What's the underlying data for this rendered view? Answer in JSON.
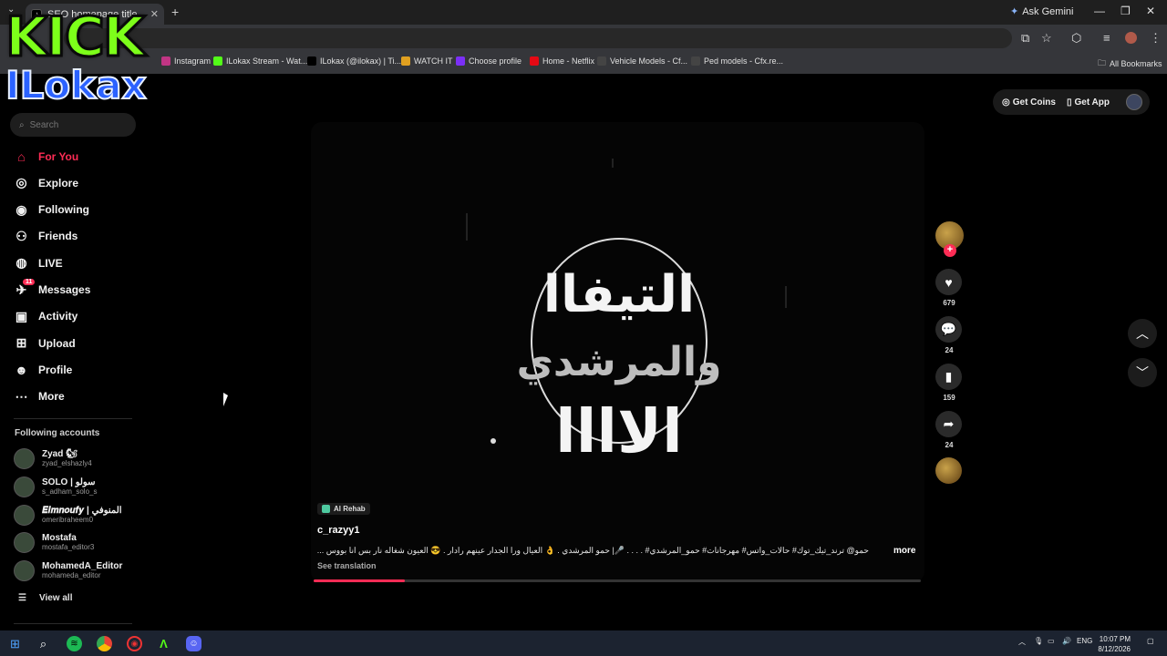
{
  "browser": {
    "tab_title": "SEO homepage title",
    "new_tab": "+",
    "ask_gemini": "Ask Gemini",
    "bookmarks": [
      {
        "label": "Instagram",
        "color": "#c13584"
      },
      {
        "label": "ILokax Stream - Wat...",
        "color": "#53fc18"
      },
      {
        "label": "ILokax (@ilokax) | Ti...",
        "color": "#000000"
      },
      {
        "label": "WATCH IT",
        "color": "#e0a020"
      },
      {
        "label": "Choose profile",
        "color": "#7b2ff7"
      },
      {
        "label": "Home - Netflix",
        "color": "#e50914"
      },
      {
        "label": "Vehicle Models - Cf...",
        "color": "#444444"
      },
      {
        "label": "Ped models - Cfx.re...",
        "color": "#444444"
      }
    ],
    "all_bookmarks": "All Bookmarks"
  },
  "overlay": {
    "line1": "KICK",
    "line2": "ILokax"
  },
  "sidebar": {
    "search_placeholder": "Search",
    "items": [
      {
        "label": "For You",
        "icon": "home-icon",
        "active": true
      },
      {
        "label": "Explore",
        "icon": "compass-icon",
        "active": false
      },
      {
        "label": "Following",
        "icon": "following-icon",
        "active": false
      },
      {
        "label": "Friends",
        "icon": "friends-icon",
        "active": false
      },
      {
        "label": "LIVE",
        "icon": "live-icon",
        "active": false
      },
      {
        "label": "Messages",
        "icon": "messages-icon",
        "active": false
      },
      {
        "label": "Activity",
        "icon": "activity-icon",
        "active": false
      },
      {
        "label": "Upload",
        "icon": "upload-icon",
        "active": false
      },
      {
        "label": "Profile",
        "icon": "profile-icon",
        "active": false
      },
      {
        "label": "More",
        "icon": "more-icon",
        "active": false
      }
    ],
    "messages_badge": "11",
    "following_title": "Following accounts",
    "accounts": [
      {
        "name": "Zyad 🐿",
        "handle": "zyad_elshazly4"
      },
      {
        "name": "SOLO | سولو",
        "handle": "s_adham_solo_s"
      },
      {
        "name": "𝑬𝒍𝒎𝒏𝒐𝒖𝒇𝒚 | المنوفي",
        "handle": "omeribraheem0"
      },
      {
        "name": "Mostafa",
        "handle": "mostafa_editor3"
      },
      {
        "name": "MohamedA_Editor",
        "handle": "mohameda_editor"
      }
    ],
    "view_all": "View all"
  },
  "topbar": {
    "get_coins": "Get Coins",
    "get_app": "Get App"
  },
  "video": {
    "effect_label": "Al Rehab",
    "author": "c_razyy1",
    "caption": "حمو@ ترند_تيك_توك# حالات_واتس# مهرجانات# حمو_المرشدي# . . . . 🎤| حمو المرشدي . 👌 العيال ورا الجدار عينهم رادار . 😎 العيون شغاله نار بس انا بووس ...",
    "more": "more",
    "see_translation": "See translation",
    "progress": 0.15,
    "title_lines": [
      "التيفاا",
      "والمرشدي",
      "الاااا"
    ]
  },
  "actions": {
    "likes": "679",
    "comments": "24",
    "saves": "159",
    "shares": "24"
  },
  "taskbar": {
    "lang": "ENG",
    "time": "10:07 PM",
    "date": "8/12/2026"
  }
}
